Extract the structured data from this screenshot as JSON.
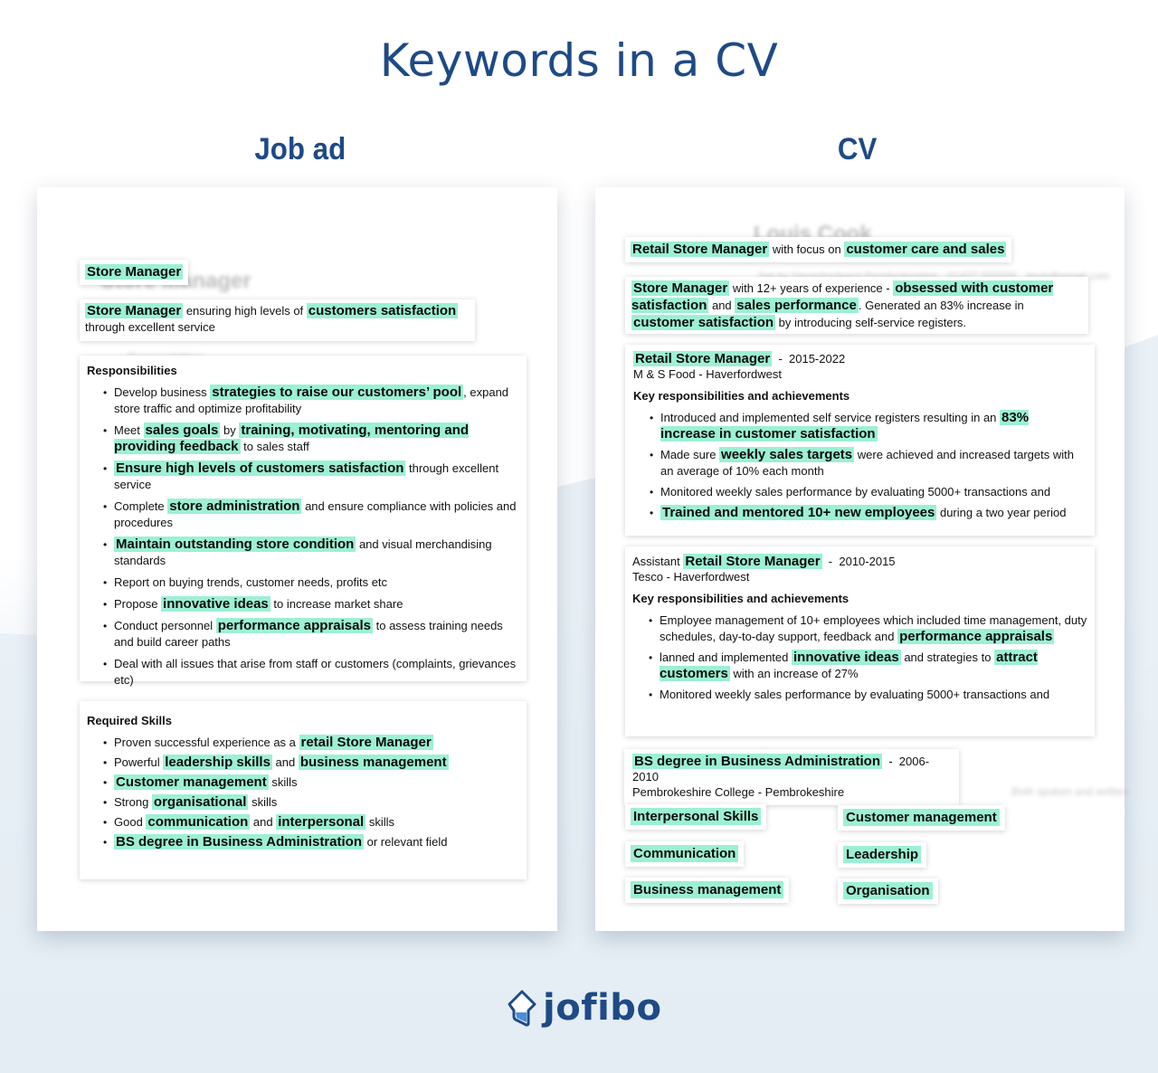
{
  "title": "Keywords in a CV",
  "columns": {
    "job_ad": "Job ad",
    "cv": "CV"
  },
  "colors": {
    "accent": "#1e4a86",
    "highlight": "#9cf0d4"
  },
  "job_ad": {
    "ghost_title": "Store Manager",
    "job_title": "Store Manager",
    "summary": {
      "kw1": "Store Manager",
      "t1": " ensuring high levels of ",
      "kw2": "customers satisfaction",
      "t2": "through excellent service"
    },
    "responsibilities": {
      "heading": "Responsibilities",
      "items": [
        {
          "pre": "Develop business ",
          "kw": "strategies to raise our customers’ pool",
          "post": ", expand store traffic and optimize profitability"
        },
        {
          "pre": "Meet ",
          "kw": "sales goals",
          "mid": " by ",
          "kw2": "training, motivating, mentoring and providing feedback",
          "post": " to sales staff"
        },
        {
          "pre": "",
          "kw": "Ensure high levels of customers satisfaction",
          "post": " through excellent service"
        },
        {
          "pre": "Complete ",
          "kw": "store administration",
          "post": " and ensure compliance with policies and procedures"
        },
        {
          "pre": "",
          "kw": "Maintain outstanding store condition",
          "post": " and visual merchandising standards"
        },
        {
          "pre": "Report on buying trends, customer needs, profits etc",
          "kw": "",
          "post": ""
        },
        {
          "pre": "Propose ",
          "kw": "innovative ideas",
          "post": " to increase market share"
        },
        {
          "pre": "Conduct personnel ",
          "kw": "performance appraisals",
          "post": " to assess training needs and build career paths"
        },
        {
          "pre": "Deal with all issues that arise from staff or customers (complaints, grievances etc)",
          "kw": "",
          "post": ""
        }
      ]
    },
    "skills": {
      "heading": "Required Skills",
      "items": [
        {
          "pre": "Proven successful experience as a ",
          "kw": "retail Store Manager",
          "post": ""
        },
        {
          "pre": "Powerful ",
          "kw": "leadership skills",
          "mid": " and ",
          "kw2": "business management",
          "post": ""
        },
        {
          "pre": "",
          "kw": "Customer management",
          "post": " skills"
        },
        {
          "pre": "Strong ",
          "kw": "organisational",
          "post": " skills"
        },
        {
          "pre": "Good ",
          "kw": "communication",
          "mid": " and ",
          "kw2": "interpersonal",
          "post": " skills"
        },
        {
          "pre": "",
          "kw": "BS degree in Business Administration",
          "post": " or relevant field"
        }
      ]
    }
  },
  "cv": {
    "ghost_name": "Louis Cook",
    "headline": {
      "kw1": "Retail Store Manager",
      "t1": " with focus on ",
      "kw2": "customer care and sales"
    },
    "summary": {
      "kw1": "Store Manager",
      "t1": " with 12+ years of experience - ",
      "kw2": "obsessed with customer satisfaction",
      "t2": " and ",
      "kw3": "sales performance",
      "t3": ". Generated an 83% increase in ",
      "kw4": "customer satisfaction",
      "t4": " by introducing self-service registers."
    },
    "job1": {
      "title_kw": "Retail Store Manager",
      "dates": "2015-2022",
      "company": "M & S Food - Haverfordwest",
      "heading": "Key responsibilities and achievements",
      "items": [
        {
          "pre": "Introduced and implemented self service registers resulting in an ",
          "kw": "83% increase in customer satisfaction",
          "post": ""
        },
        {
          "pre": " Made sure ",
          "kw": "weekly sales targets",
          "post": " were achieved and increased targets with an average of 10% each month"
        },
        {
          "pre": " Monitored weekly sales performance by evaluating 5000+ transactions and",
          "kw": "",
          "post": ""
        },
        {
          "pre": " ",
          "kw": "Trained and mentored 10+ new employees",
          "post": " during a two year period"
        }
      ]
    },
    "job2": {
      "title_pre": "Assistant ",
      "title_kw": "Retail Store Manager",
      "dates": "2010-2015",
      "company": "Tesco - Haverfordwest",
      "heading": "Key responsibilities and achievements",
      "items": [
        {
          "pre": "Employee management of 10+ employees which included time management, duty schedules, day-to-day support, feedback and ",
          "kw": "performance appraisals",
          "post": ""
        },
        {
          "pre": "lanned and implemented ",
          "kw": "innovative ideas",
          "mid": " and strategies to ",
          "kw2": "attract customers",
          "post": " with an increase of 27%"
        },
        {
          "pre": "Monitored weekly sales performance by evaluating 5000+ transactions and",
          "kw": "",
          "post": ""
        }
      ]
    },
    "education": {
      "degree_kw": "BS degree in Business Administration",
      "dates": "2006-2010",
      "school": "Pembrokeshire College - Pembrokeshire"
    },
    "skills": [
      "Interpersonal Skills",
      "Customer management",
      "Communication",
      "Leadership",
      "Business management",
      "Organisation"
    ]
  },
  "logo": {
    "text": "jofibo",
    "icon": "jofibo-logo-icon"
  }
}
